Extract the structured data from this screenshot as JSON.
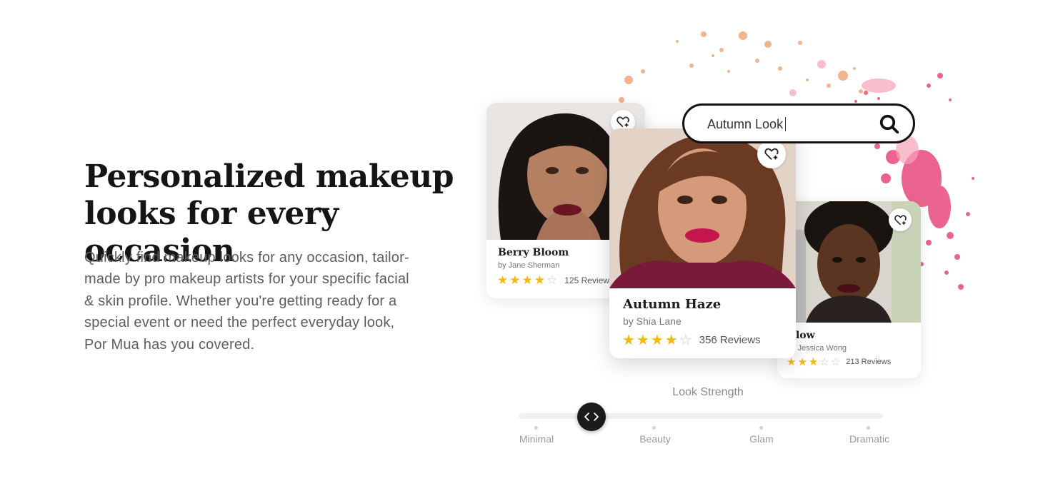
{
  "hero": {
    "title": "Personalized makeup looks for every occasion",
    "body": "Quickly find makeup looks for any occasion, tailor-made by pro makeup artists for your specific facial & skin profile. Whether you're getting ready for a special event or need the perfect everyday look, Por Mua has you covered."
  },
  "search": {
    "value": "Autumn Look"
  },
  "cards": [
    {
      "title": "Berry Bloom",
      "author": "by Jane Sherman",
      "rating": 4,
      "reviews": "125 Reviews"
    },
    {
      "title": "Autumn Haze",
      "author": "by Shia Lane",
      "rating": 4,
      "reviews": "356 Reviews"
    },
    {
      "title": "Glow",
      "author": "by Jessica Wong",
      "rating": 3,
      "reviews": "213 Reviews"
    }
  ],
  "slider": {
    "label": "Look Strength",
    "stops": [
      "Minimal",
      "Beauty",
      "Glam",
      "Dramatic"
    ],
    "value_fraction": 0.2
  },
  "colors": {
    "star": "#f5b80b",
    "star_empty": "#c9c9c9",
    "thumb": "#1b1b1b",
    "search_border": "#111111"
  },
  "icons": {
    "favorite": "heart-plus-icon",
    "search": "search-icon",
    "slider": "chevron-left-right-icon"
  }
}
